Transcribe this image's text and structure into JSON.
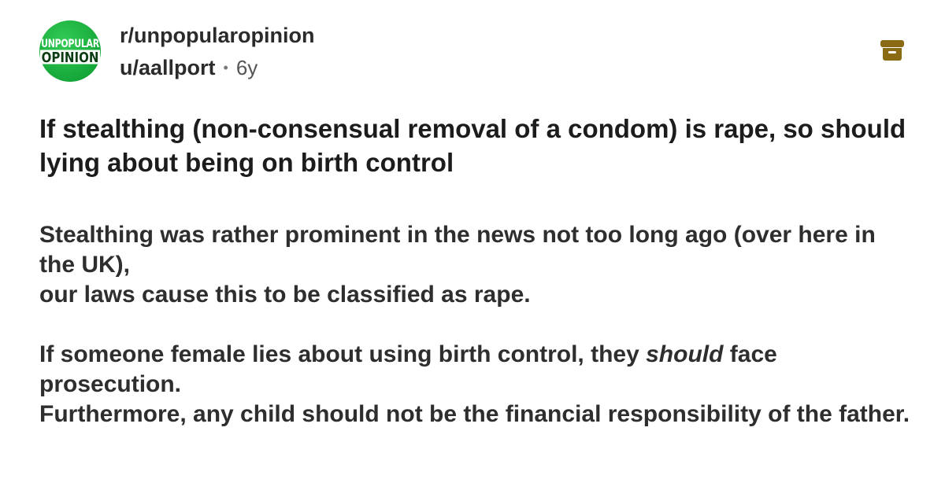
{
  "post": {
    "subreddit_icon": {
      "line1": "UNPOPULAR",
      "line2": "OPINION",
      "color": "#1db954"
    },
    "subreddit": "r/unpopularopinion",
    "author": "u/aallport",
    "separator": "•",
    "age": "6y",
    "archive_icon": "archive-icon",
    "archive_color": "#8a6a12",
    "title": "If stealthing (non-consensual removal of a condom) is rape, so should lying about being on birth control",
    "body": {
      "p1_line1": "Stealthing was rather prominent in the news not too long ago (over here in the UK),",
      "p1_line2": "our laws cause this to be classified as rape.",
      "p2_before": "If someone female lies about using birth control, they ",
      "p2_emphasis": "should",
      "p2_after": " face prosecution.",
      "p2_line2": "Furthermore, any child should not be the financial responsibility of the father."
    }
  }
}
